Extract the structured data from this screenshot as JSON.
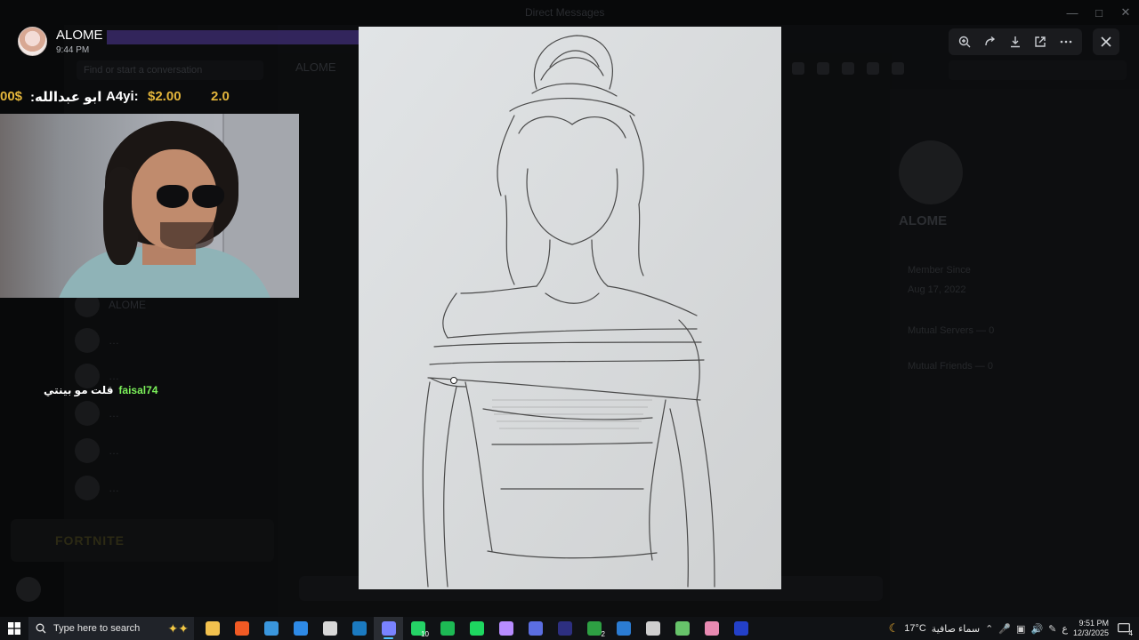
{
  "window": {
    "title": "Direct Messages",
    "controls": [
      "minimize-icon",
      "maximize-icon",
      "close-icon"
    ]
  },
  "background": {
    "find_placeholder": "Find or start a conversation",
    "chat_header_name": "ALOME",
    "dm_list": [
      "ALOME",
      "…",
      "…",
      "…",
      "…",
      "…"
    ],
    "fortnite_label": "FORTNITE",
    "profile": {
      "name": "ALOME",
      "member_since_label": "Member Since",
      "member_since_value": "Aug 17, 2022",
      "mutual_servers": "Mutual Servers — 0",
      "mutual_friends": "Mutual Friends — 0"
    }
  },
  "notification": {
    "name": "ALOME",
    "time": "9:44 PM"
  },
  "ticker": {
    "items": [
      {
        "text": "00$",
        "color": "gold"
      },
      {
        "text": ":ابو عبدالله",
        "color": "white"
      },
      {
        "text": "A4yi:",
        "color": "white"
      },
      {
        "text": "$2.00",
        "color": "gold"
      },
      {
        "text": "2.0",
        "color": "gold"
      }
    ]
  },
  "stream_chat": {
    "user": "faisal74",
    "message": "قلت مو بينتي"
  },
  "viewer": {
    "tools": [
      "zoom-in-icon",
      "rotate-icon",
      "download-icon",
      "open-external-icon",
      "more-icon"
    ],
    "close_icon": "close-icon"
  },
  "taskbar": {
    "search_placeholder": "Type here to search",
    "apps": [
      {
        "name": "file-explorer-icon",
        "color": "#f2c14e"
      },
      {
        "name": "brave-icon",
        "color": "#f15a24"
      },
      {
        "name": "store-icon",
        "color": "#3a96dd"
      },
      {
        "name": "mail-icon",
        "color": "#2e8ae6"
      },
      {
        "name": "obs-icon",
        "color": "#d8d8d8"
      },
      {
        "name": "steam-icon",
        "color": "#1b7ac0"
      },
      {
        "name": "discord-icon",
        "color": "#7a83ff",
        "active": true
      },
      {
        "name": "whatsapp-icon",
        "color": "#25d366",
        "badge": "10"
      },
      {
        "name": "app-green-icon",
        "color": "#1db954"
      },
      {
        "name": "spotify-icon",
        "color": "#1ed760"
      },
      {
        "name": "app-purple-icon",
        "color": "#b78cff"
      },
      {
        "name": "app-vpn-icon",
        "color": "#5b6ee1"
      },
      {
        "name": "app-dark-icon",
        "color": "#2d2f80"
      },
      {
        "name": "xbox-icon",
        "color": "#2ea043",
        "badge": "2"
      },
      {
        "name": "word-icon",
        "color": "#2b7cd3"
      },
      {
        "name": "app-pen-icon",
        "color": "#cfcfcf"
      },
      {
        "name": "app-map-icon",
        "color": "#67c36a"
      },
      {
        "name": "app-pink-icon",
        "color": "#e88ab2"
      },
      {
        "name": "fresco-icon",
        "color": "#2340c8"
      }
    ],
    "weather_temp": "17°C",
    "weather_text": "سماء صافية",
    "input_lang": "ع",
    "time": "9:51 PM",
    "date": "12/3/2025",
    "notifications_count": "4"
  }
}
